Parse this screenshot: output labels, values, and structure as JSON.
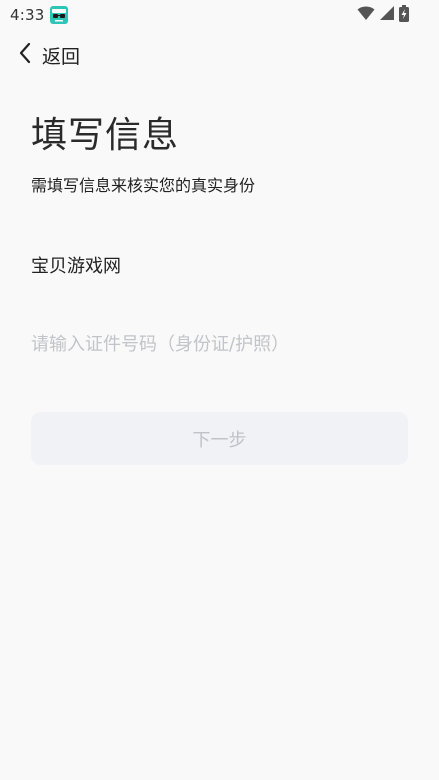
{
  "status_bar": {
    "time": "4:33",
    "app_icon": "sunglasses-app-icon",
    "wifi_icon": "wifi-icon",
    "signal_icon": "cellular-signal-icon",
    "battery_icon": "battery-charging-icon"
  },
  "nav": {
    "back_icon": "chevron-left-icon",
    "back_label": "返回"
  },
  "page": {
    "title": "填写信息",
    "subtitle": "需填写信息来核实您的真实身份"
  },
  "form": {
    "name_value": "宝贝游戏网",
    "id_value": "",
    "id_placeholder": "请输入证件号码（身份证/护照）"
  },
  "actions": {
    "next_label": "下一步"
  },
  "colors": {
    "background": "#f9f9f9",
    "button_disabled_bg": "#f1f2f5",
    "button_disabled_text": "#c0c2c8",
    "placeholder": "#c2c4ca",
    "app_icon_accent": "#2ec4b6"
  }
}
